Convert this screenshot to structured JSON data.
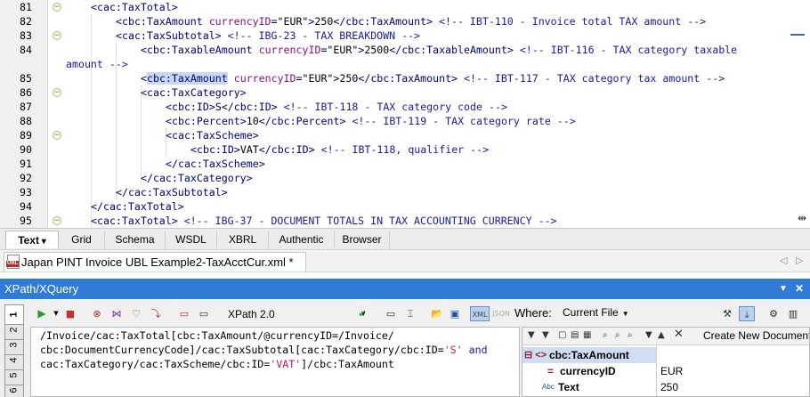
{
  "editor": {
    "lines": [
      {
        "n": "81",
        "fold": "−",
        "segs": [
          {
            "c": "tag",
            "t": "<cac:TaxTotal>"
          }
        ]
      },
      {
        "n": "82",
        "fold": "",
        "segs": [
          {
            "c": "tag",
            "t": "<cbc:TaxAmount "
          },
          {
            "c": "an",
            "t": "currencyID"
          },
          {
            "c": "tag",
            "t": "="
          },
          {
            "c": "av",
            "t": "\"EUR\""
          },
          {
            "c": "tag",
            "t": ">"
          },
          {
            "c": "tx",
            "t": "250"
          },
          {
            "c": "tag",
            "t": "</cbc:TaxAmount>"
          },
          {
            "c": "tx",
            "t": " "
          },
          {
            "c": "cm",
            "t": "<!-- IBT-110 - Invoice total TAX amount -->"
          }
        ]
      },
      {
        "n": "83",
        "fold": "−",
        "segs": [
          {
            "c": "tag",
            "t": "<cac:TaxSubtotal>"
          },
          {
            "c": "tx",
            "t": " "
          },
          {
            "c": "cm",
            "t": "<!-- IBG-23 - TAX BREAKDOWN -->"
          }
        ]
      },
      {
        "n": "84",
        "fold": "",
        "segs": [
          {
            "c": "tag",
            "t": "<cbc:TaxableAmount "
          },
          {
            "c": "an",
            "t": "currencyID"
          },
          {
            "c": "tag",
            "t": "="
          },
          {
            "c": "av",
            "t": "\"EUR\""
          },
          {
            "c": "tag",
            "t": ">"
          },
          {
            "c": "tx",
            "t": "2500"
          },
          {
            "c": "tag",
            "t": "</cbc:TaxableAmount>"
          },
          {
            "c": "tx",
            "t": " "
          },
          {
            "c": "cm",
            "t": "<!-- IBT-116 - TAX category taxable"
          }
        ]
      },
      {
        "n": "",
        "fold": "",
        "segs": [
          {
            "c": "cm",
            "t": "amount -->"
          }
        ]
      },
      {
        "n": "85",
        "fold": "",
        "segs": [
          {
            "c": "tag",
            "t": "<"
          },
          {
            "c": "tag hl",
            "t": "cbc:TaxAmount"
          },
          {
            "c": "tag",
            "t": " "
          },
          {
            "c": "an",
            "t": "currencyID"
          },
          {
            "c": "tag",
            "t": "="
          },
          {
            "c": "av",
            "t": "\"EUR\""
          },
          {
            "c": "tag",
            "t": ">"
          },
          {
            "c": "tx",
            "t": "250"
          },
          {
            "c": "tag",
            "t": "</cbc:TaxAmount>"
          },
          {
            "c": "tx",
            "t": " "
          },
          {
            "c": "cm",
            "t": "<!-- IBT-117 - TAX category tax amount -->"
          }
        ]
      },
      {
        "n": "86",
        "fold": "−",
        "segs": [
          {
            "c": "tag",
            "t": "<cac:TaxCategory>"
          }
        ]
      },
      {
        "n": "87",
        "fold": "",
        "segs": [
          {
            "c": "tag",
            "t": "<cbc:ID>"
          },
          {
            "c": "tx",
            "t": "S"
          },
          {
            "c": "tag",
            "t": "</cbc:ID>"
          },
          {
            "c": "tx",
            "t": " "
          },
          {
            "c": "cm",
            "t": "<!-- IBT-118 - TAX category code -->"
          }
        ]
      },
      {
        "n": "88",
        "fold": "",
        "segs": [
          {
            "c": "tag",
            "t": "<cbc:Percent>"
          },
          {
            "c": "tx",
            "t": "10"
          },
          {
            "c": "tag",
            "t": "</cbc:Percent>"
          },
          {
            "c": "tx",
            "t": " "
          },
          {
            "c": "cm",
            "t": "<!-- IBT-119 - TAX category rate -->"
          }
        ]
      },
      {
        "n": "89",
        "fold": "−",
        "segs": [
          {
            "c": "tag",
            "t": "<cac:TaxScheme>"
          }
        ]
      },
      {
        "n": "90",
        "fold": "",
        "segs": [
          {
            "c": "tag",
            "t": "<cbc:ID>"
          },
          {
            "c": "tx",
            "t": "VAT"
          },
          {
            "c": "tag",
            "t": "</cbc:ID>"
          },
          {
            "c": "tx",
            "t": " "
          },
          {
            "c": "cm",
            "t": "<!-- IBT-118, qualifier -->"
          }
        ]
      },
      {
        "n": "91",
        "fold": "",
        "segs": [
          {
            "c": "tag",
            "t": "</cac:TaxScheme>"
          }
        ]
      },
      {
        "n": "92",
        "fold": "",
        "segs": [
          {
            "c": "tag",
            "t": "</cac:TaxCategory>"
          }
        ]
      },
      {
        "n": "93",
        "fold": "",
        "segs": [
          {
            "c": "tag",
            "t": "</cac:TaxSubtotal>"
          }
        ]
      },
      {
        "n": "94",
        "fold": "",
        "segs": [
          {
            "c": "tag",
            "t": "</cac:TaxTotal>"
          }
        ]
      },
      {
        "n": "95",
        "fold": "−",
        "segs": [
          {
            "c": "tag",
            "t": "<cac:TaxTotal>"
          },
          {
            "c": "tx",
            "t": " "
          },
          {
            "c": "cm",
            "t": "<!-- IBG-37 - DOCUMENT TOTALS IN TAX ACCOUNTING CURRENCY -->"
          }
        ]
      }
    ]
  },
  "view_tabs": [
    "Text",
    "Grid",
    "Schema",
    "WSDL",
    "XBRL",
    "Authentic",
    "Browser"
  ],
  "active_view_tab": "Text",
  "doc_tab": {
    "title": "Japan PINT Invoice UBL Example2-TaxAcctCur.xml *",
    "icon_text": "UBL"
  },
  "xpath": {
    "panel_title": "XPath/XQuery",
    "side_tabs": [
      "1",
      "2",
      "3",
      "4",
      "5",
      "6"
    ],
    "version": "XPath 2.0",
    "where_label": "Where:",
    "where_value": "Current File",
    "json_label": "JSON",
    "expression_lines": [
      [
        {
          "c": "p",
          "t": "/Invoice/cac:TaxTotal[cbc:TaxAmount/@currencyID=/Invoice/"
        }
      ],
      [
        {
          "c": "p",
          "t": "cbc:DocumentCurrencyCode]/cac:TaxSubtotal[cac:TaxCategory/cbc:ID="
        },
        {
          "c": "sq",
          "t": "'S'"
        },
        {
          "c": "p",
          "t": " "
        },
        {
          "c": "kw",
          "t": "and"
        }
      ],
      [
        {
          "c": "p",
          "t": "cac:TaxCategory/cac:TaxScheme/cbc:ID="
        },
        {
          "c": "sq",
          "t": "'VAT'"
        },
        {
          "c": "p",
          "t": "]/cbc:TaxAmount"
        }
      ]
    ],
    "create_doc_label": "Create New Document",
    "results": [
      {
        "icon": "⊟ <>",
        "name": "cbc:TaxAmount",
        "value": "",
        "selected": true
      },
      {
        "icon": "=",
        "name": "currencyID",
        "value": "EUR",
        "selected": false
      },
      {
        "icon": "Abc",
        "name": "Text",
        "value": "250",
        "selected": false
      }
    ]
  }
}
